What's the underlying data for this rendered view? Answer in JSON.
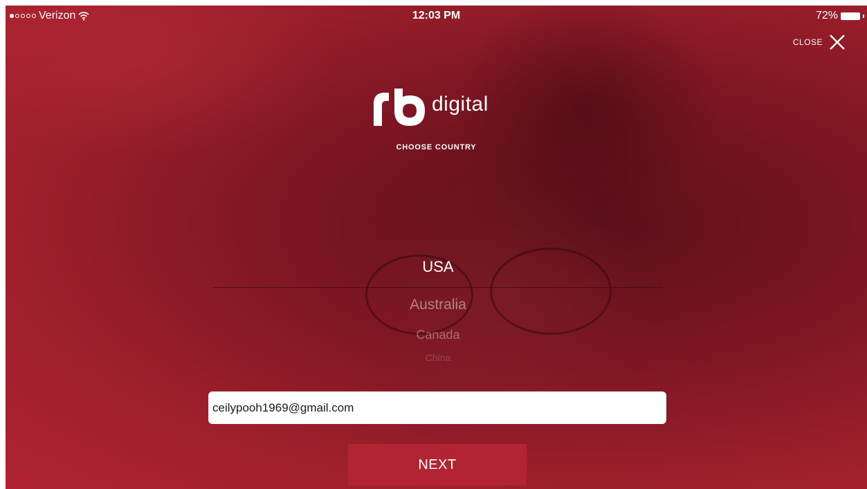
{
  "status_bar": {
    "carrier": "Verizon",
    "time": "12:03 PM",
    "battery": "72%",
    "signal_bars_filled": 1,
    "signal_bars_total": 5
  },
  "close": {
    "label": "CLOSE",
    "icon": "close-icon"
  },
  "logo": {
    "mark": "rb",
    "text": "digital"
  },
  "heading": "CHOOSE COUNTRY",
  "country_picker": {
    "selected": "USA",
    "options": [
      "Australia",
      "Canada",
      "China"
    ]
  },
  "email": {
    "value": "ceilypooh1969@gmail.com"
  },
  "next_button": "NEXT",
  "colors": {
    "primary_red": "#b22432",
    "overlay_dark": "#5a0f1a",
    "text": "#ffffff"
  }
}
